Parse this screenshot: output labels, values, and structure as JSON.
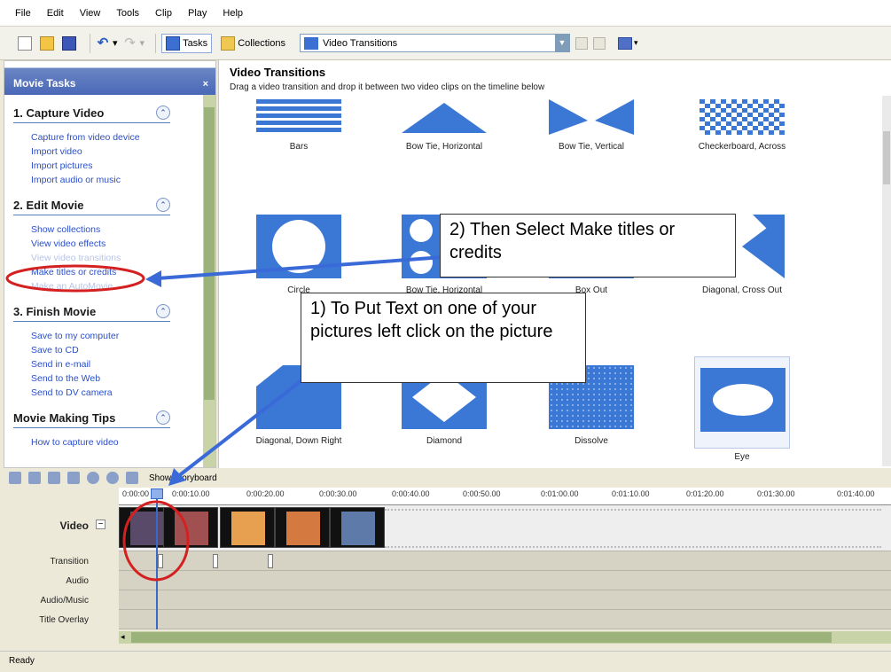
{
  "menu": [
    "File",
    "Edit",
    "View",
    "Tools",
    "Clip",
    "Play",
    "Help"
  ],
  "toolbar": {
    "tasks_label": "Tasks",
    "collections_label": "Collections",
    "combo_value": "Video Transitions"
  },
  "taskpane": {
    "header": "Movie Tasks",
    "close": "×",
    "sections": [
      {
        "title": "1. Capture Video",
        "links": [
          "Capture from video device",
          "Import video",
          "Import pictures",
          "Import audio or music"
        ]
      },
      {
        "title": "2. Edit Movie",
        "links": [
          "Show collections",
          "View video effects",
          "View video transitions",
          "Make titles or credits",
          "Make an AutoMovie"
        ]
      },
      {
        "title": "3. Finish Movie",
        "links": [
          "Save to my computer",
          "Save to CD",
          "Send in e-mail",
          "Send to the Web",
          "Send to DV camera"
        ]
      },
      {
        "title": "Movie Making Tips",
        "links": [
          "How to capture video"
        ]
      }
    ]
  },
  "content": {
    "title": "Video Transitions",
    "description": "Drag a video transition and drop it between two video clips on the timeline below",
    "tiles": [
      "Bars",
      "Bow Tie, Horizontal",
      "Bow Tie, Vertical",
      "Checkerboard, Across",
      "Circle",
      "Bow Tie, Horizontal",
      "Box Out",
      "Diagonal, Cross Out",
      "Diagonal, Down Right",
      "Diamond",
      "Dissolve",
      "Eye"
    ]
  },
  "timeline": {
    "show_storyboard": "Show Storyboard",
    "ticks": [
      "0:00:00",
      "0:00:10.00",
      "0:00:20.00",
      "0:00:30.00",
      "0:00:40.00",
      "0:00:50.00",
      "0:01:00.00",
      "0:01:10.00",
      "0:01:20.00",
      "0:01:30.00",
      "0:01:40.00"
    ],
    "tracks": [
      "Video",
      "Transition",
      "Audio",
      "Audio/Music",
      "Title Overlay"
    ]
  },
  "status": "Ready",
  "callouts": {
    "step1": "1)   To Put Text on one of your pictures left click on the picture",
    "step2": "2)  Then Select Make titles or credits"
  },
  "colors": {
    "accent": "#3b78d6",
    "annotation_red": "#d42020",
    "arrow_blue": "#3a6ad8"
  }
}
